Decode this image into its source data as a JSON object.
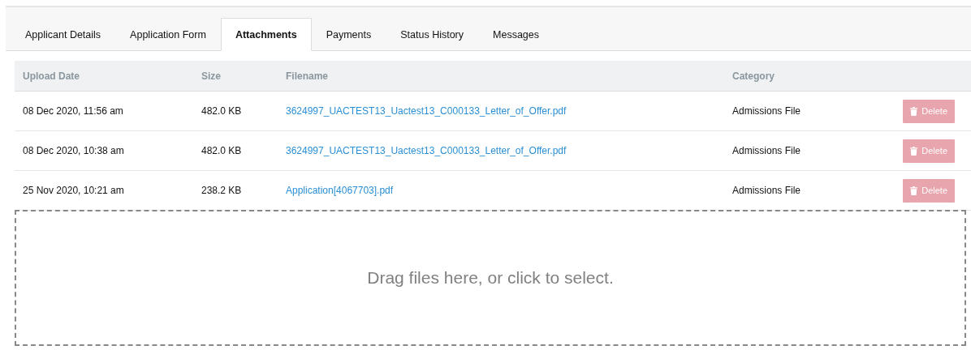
{
  "tabs": [
    {
      "label": "Applicant Details",
      "selected": false
    },
    {
      "label": "Application Form",
      "selected": false
    },
    {
      "label": "Attachments",
      "selected": true
    },
    {
      "label": "Payments",
      "selected": false
    },
    {
      "label": "Status History",
      "selected": false
    },
    {
      "label": "Messages",
      "selected": false
    }
  ],
  "table": {
    "columns": [
      "Upload Date",
      "Size",
      "Filename",
      "Category"
    ],
    "rows": [
      {
        "date": "08 Dec 2020, 11:56 am",
        "size": "482.0 KB",
        "filename": "3624997_UACTEST13_Uactest13_C000133_Letter_of_Offer.pdf",
        "category": "Admissions File",
        "action": "Delete"
      },
      {
        "date": "08 Dec 2020, 10:38 am",
        "size": "482.0 KB",
        "filename": "3624997_UACTEST13_Uactest13_C000133_Letter_of_Offer.pdf",
        "category": "Admissions File",
        "action": "Delete"
      },
      {
        "date": "25 Nov 2020, 10:21 am",
        "size": "238.2 KB",
        "filename": "Application[4067703].pdf",
        "category": "Admissions File",
        "action": "Delete"
      }
    ]
  },
  "dropzone": {
    "text": "Drag files here, or click to select."
  }
}
